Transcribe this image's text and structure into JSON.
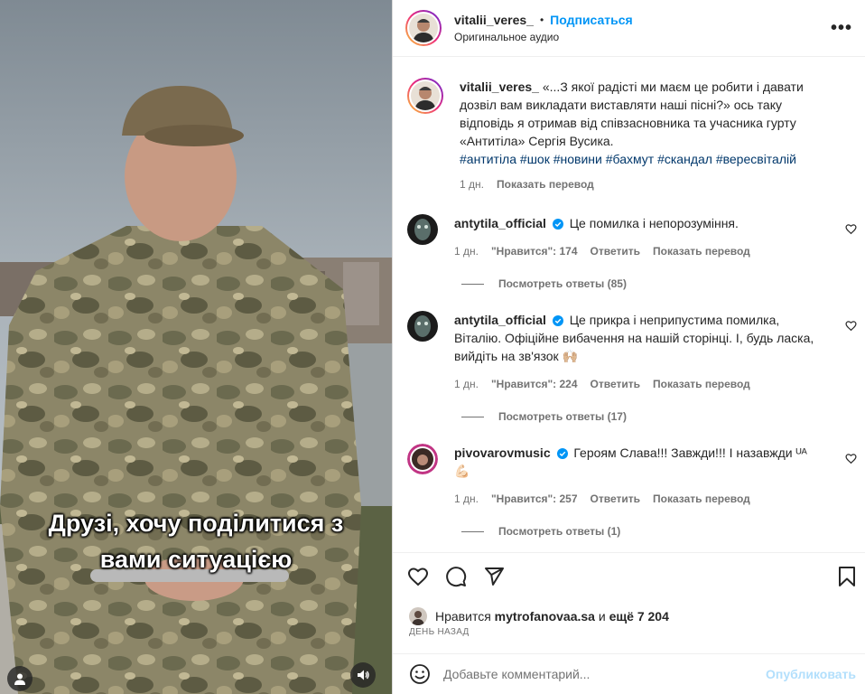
{
  "video": {
    "caption_line1": "Друзі, хочу поділитися з",
    "caption_line2": "вами ситуацією",
    "user_icon": "user-icon",
    "sound_icon": "speaker-icon"
  },
  "header": {
    "username": "vitalii_veres_",
    "separator": "•",
    "follow_label": "Подписаться",
    "audio_label": "Оригинальное аудио",
    "more_label": "•••"
  },
  "caption": {
    "username": "vitalii_veres_",
    "text": "«...З якої радісті ми маєм це робити і давати дозвіл вам викладати виставляти наші пісні?» ось таку відповідь я отримав від співзасновника та учасника гурту «Антитіла» Сергія Вусика.",
    "hashtags": "#антитіла #шок #новини #бахмут #скандал #вересвіталій",
    "age": "1 дн.",
    "translate": "Показать перевод"
  },
  "comments": [
    {
      "username": "antytila_official",
      "text": "Це помилка і непорозуміння.",
      "age": "1 дн.",
      "likes": "\"Нравится\": 174",
      "reply": "Ответить",
      "translate": "Показать перевод",
      "view_replies": "Посмотреть ответы (85)"
    },
    {
      "username": "antytila_official",
      "text": "Це прикра і неприпустима помилка, Віталію. Офіційне вибачення на нашій сторінці. І, будь ласка, вийдіть на зв'язок 🙌🏼",
      "age": "1 дн.",
      "likes": "\"Нравится\": 224",
      "reply": "Ответить",
      "translate": "Показать перевод",
      "view_replies": "Посмотреть ответы (17)"
    },
    {
      "username": "pivovarovmusic",
      "text": "Героям Слава!!! Завжди!!! І назавжди ᵁᴬ 💪🏻",
      "age": "1 дн.",
      "likes": "\"Нравится\": 257",
      "reply": "Ответить",
      "translate": "Показать перевод",
      "view_replies": "Посмотреть ответы (1)"
    }
  ],
  "actions": {
    "like_icon": "heart-icon",
    "comment_icon": "comment-icon",
    "share_icon": "send-icon",
    "save_icon": "bookmark-icon"
  },
  "likes": {
    "prefix": "Нравится",
    "user": "mytrofanovaa.sa",
    "conj": "и",
    "more": "ещё 7 204"
  },
  "date_label": "ДЕНЬ НАЗАД",
  "add_comment": {
    "placeholder": "Добавьте комментарий...",
    "publish": "Опубликовать"
  },
  "colors": {
    "accent": "#0095f6",
    "link": "#00376b",
    "muted": "#737373",
    "verified": "#0095f6"
  }
}
